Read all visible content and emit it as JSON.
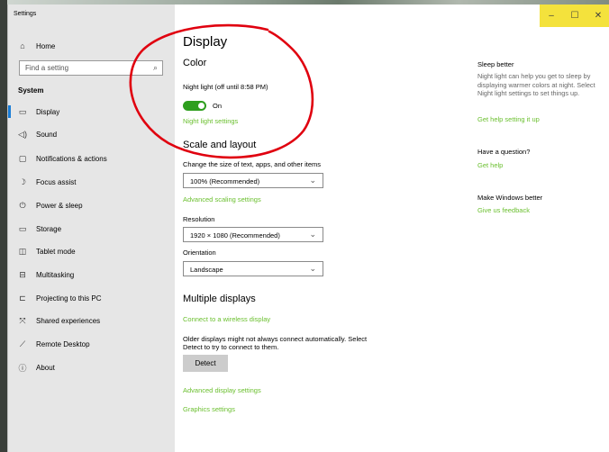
{
  "window": {
    "title": "Settings",
    "controls": {
      "minimize": "–",
      "maximize": "☐",
      "close": "✕"
    }
  },
  "sidebar": {
    "home": "Home",
    "search_placeholder": "Find a setting",
    "section": "System",
    "items": [
      {
        "label": "Display",
        "icon": "monitor-icon"
      },
      {
        "label": "Sound",
        "icon": "speaker-icon"
      },
      {
        "label": "Notifications & actions",
        "icon": "message-icon"
      },
      {
        "label": "Focus assist",
        "icon": "moon-icon"
      },
      {
        "label": "Power & sleep",
        "icon": "power-icon"
      },
      {
        "label": "Storage",
        "icon": "storage-icon"
      },
      {
        "label": "Tablet mode",
        "icon": "tablet-icon"
      },
      {
        "label": "Multitasking",
        "icon": "multitasking-icon"
      },
      {
        "label": "Projecting to this PC",
        "icon": "projector-icon"
      },
      {
        "label": "Shared experiences",
        "icon": "shared-icon"
      },
      {
        "label": "Remote Desktop",
        "icon": "remote-icon"
      },
      {
        "label": "About",
        "icon": "info-icon"
      }
    ]
  },
  "main": {
    "title": "Display",
    "color": {
      "heading": "Color",
      "night_light_label": "Night light (off until 8:58 PM)",
      "toggle_state": "On",
      "night_light_settings": "Night light settings"
    },
    "scale": {
      "heading": "Scale and layout",
      "size_label": "Change the size of text, apps, and other items",
      "size_value": "100% (Recommended)",
      "advanced_scaling": "Advanced scaling settings",
      "resolution_label": "Resolution",
      "resolution_value": "1920 × 1080 (Recommended)",
      "orientation_label": "Orientation",
      "orientation_value": "Landscape"
    },
    "multiple": {
      "heading": "Multiple displays",
      "connect_link": "Connect to a wireless display",
      "description_line1": "Older displays might not always connect automatically. Select",
      "description_line2": "Detect to try to connect to them.",
      "detect_button": "Detect",
      "advanced_display": "Advanced display settings",
      "graphics": "Graphics settings"
    }
  },
  "aside": {
    "sleep_heading": "Sleep better",
    "sleep_body": "Night light can help you get to sleep by displaying warmer colors at night. Select Night light settings to set things up.",
    "sleep_link": "Get help setting it up",
    "question_heading": "Have a question?",
    "question_link": "Get help",
    "feedback_heading": "Make Windows better",
    "feedback_link": "Give us feedback"
  },
  "colors": {
    "accent_link": "#6abf2e",
    "toggle_on": "#2e9e1e",
    "annotation": "#e0000f",
    "window_controls": "#f4e23c"
  }
}
